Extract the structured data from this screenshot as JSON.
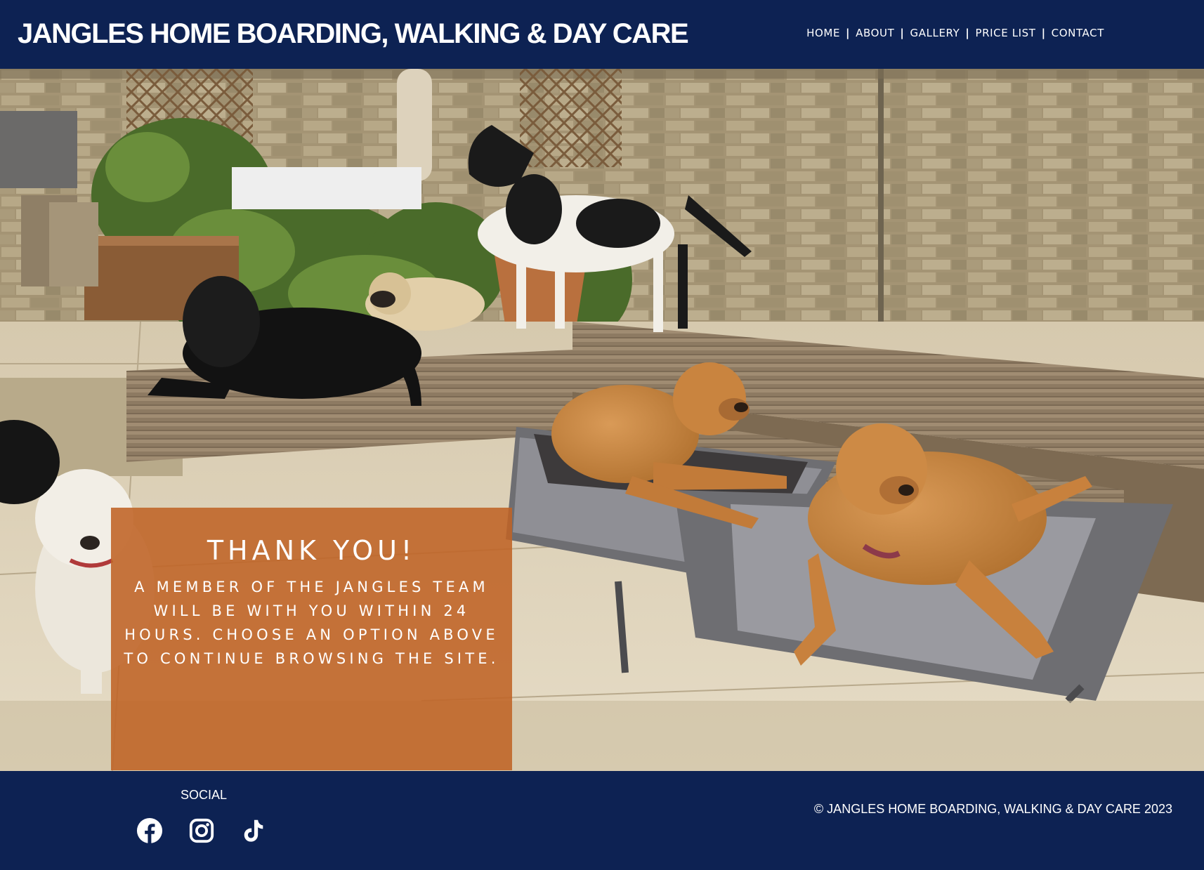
{
  "header": {
    "site_title": "JANGLES HOME BOARDING, WALKING & DAY CARE",
    "nav": [
      {
        "label": "HOME"
      },
      {
        "label": "ABOUT"
      },
      {
        "label": "GALLERY"
      },
      {
        "label": "PRICE LIST"
      },
      {
        "label": "CONTACT"
      }
    ],
    "separator": "|"
  },
  "hero": {
    "image_subject": "dogs-in-garden-photo",
    "thanks_title": "THANK YOU!",
    "thanks_message": "A MEMBER OF THE JANGLES TEAM WILL BE WITH YOU WITHIN 24 HOURS. CHOOSE AN OPTION ABOVE TO CONTINUE BROWSING THE SITE."
  },
  "footer": {
    "social_label": "SOCIAL",
    "social_icons": [
      "facebook-icon",
      "instagram-icon",
      "tiktok-icon"
    ],
    "copyright": "© JANGLES HOME BOARDING, WALKING & DAY CARE 2023"
  },
  "colors": {
    "navy": "#0d2253",
    "overlay_orange": "#bf6326",
    "text": "#ffffff"
  }
}
